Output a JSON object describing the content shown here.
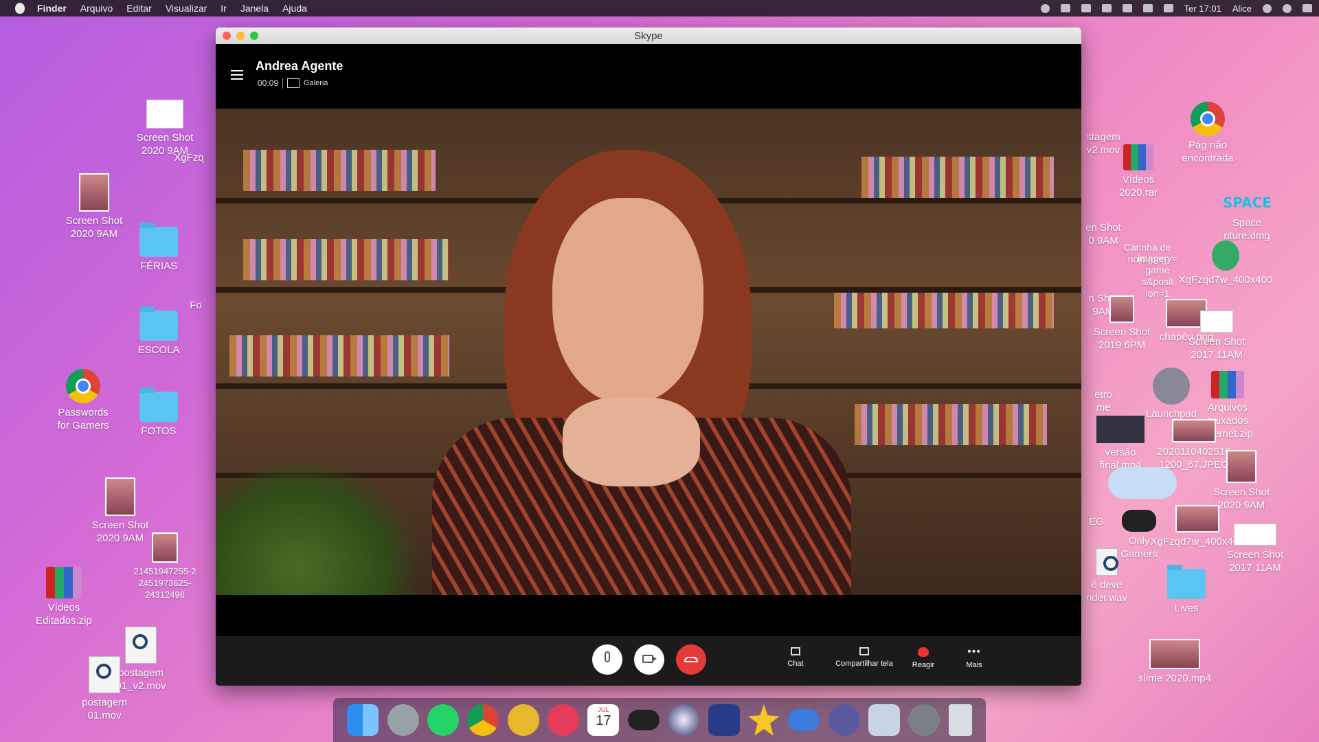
{
  "menubar": {
    "items": [
      "Finder",
      "Arquivo",
      "Editar",
      "Visualizar",
      "Ir",
      "Janela",
      "Ajuda"
    ],
    "clock": "Ter 17:01",
    "user": "Alice"
  },
  "desktop": {
    "left": [
      {
        "label": "Screen Shot\n2020 9AM"
      },
      {
        "label": "XgFzq"
      },
      {
        "label": "Screen Shot\n2020 9AM"
      },
      {
        "label": "FÉRIAS"
      },
      {
        "label": "Fo"
      },
      {
        "label": "ESCOLA"
      },
      {
        "label": "Passwords\nfor Gamers"
      },
      {
        "label": "FOTOS"
      },
      {
        "label": "Screen Shot\n2020 9AM"
      },
      {
        "label": "21451947255-2\n2451973625-\n24312496"
      },
      {
        "label": "Vídeos\nEditados.zip"
      },
      {
        "label": "postagem\n01_v2.mov"
      },
      {
        "label": "postagem\n01.mov"
      }
    ],
    "right": [
      {
        "label": "Pág não\nencontrada"
      },
      {
        "label": "stagem\nv2.mov"
      },
      {
        "label": "Vídeos\n2020.rar"
      },
      {
        "label": "SPACE"
      },
      {
        "label": "Space\nnture.dmg"
      },
      {
        "label": "en Shot\n0 9AM"
      },
      {
        "label": "Carinha de\nnojo.jpeg"
      },
      {
        "label": "imagery=\ngame\ns&posit\nion=1"
      },
      {
        "label": "XgFzqd7w_400x400"
      },
      {
        "label": "n Shot\n9AM"
      },
      {
        "label": "Screen Shot\n2019 6PM"
      },
      {
        "label": "chapéu.png"
      },
      {
        "label": "Screen Shot\n2017 11AM"
      },
      {
        "label": "etro\nme"
      },
      {
        "label": "Launchpad"
      },
      {
        "label": "Arquivos\nbaixados\ninternet.zip"
      },
      {
        "label": "versão\nfinal.mp4"
      },
      {
        "label": "2020110402510\n1200_67.JPEG"
      },
      {
        "label": "Screen Shot\n2020 9AM"
      },
      {
        "label": "EG"
      },
      {
        "label": "Only\nGamers"
      },
      {
        "label": "XgFzqd7w_400x400"
      },
      {
        "label": "Screen Shot\n2017 11AM"
      },
      {
        "label": "ê deve\nnder.wav"
      },
      {
        "label": "Lives"
      },
      {
        "label": "slime 2020.mp4"
      }
    ]
  },
  "skype": {
    "window_title": "Skype",
    "contact_name": "Andrea Agente",
    "call_timer": "00:09",
    "gallery_label": "Galeria",
    "actions": {
      "chat": "Chat",
      "share": "Compartilhar tela",
      "react": "Reagir",
      "more": "Mais"
    }
  },
  "dock": {
    "apps": [
      "finder-icon",
      "launchpad-icon",
      "whatsapp-icon",
      "chrome-icon",
      "coin-icon",
      "heart-app-icon",
      "calendar-icon",
      "gamepad-icon",
      "browser-icon",
      "game-icon",
      "star-icon",
      "controller-icon",
      "spaceship-icon",
      "preview-icon",
      "system-preferences-icon",
      "trash-icon"
    ],
    "calendar_day": "17",
    "calendar_month": "JUL"
  }
}
